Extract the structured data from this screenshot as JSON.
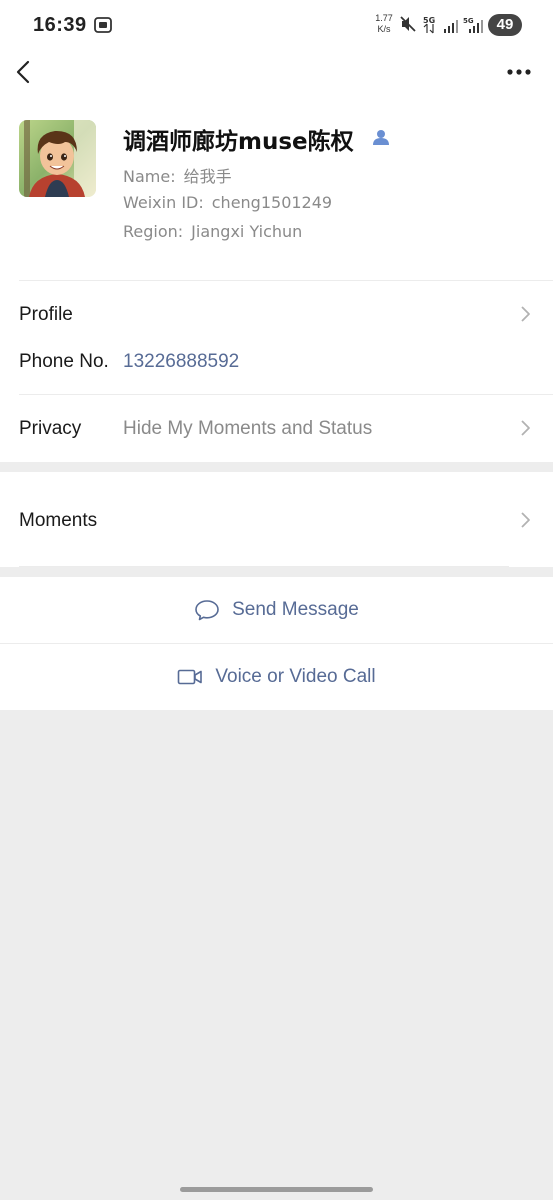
{
  "status_bar": {
    "time": "16:39",
    "net_speed_value": "1.77",
    "net_speed_unit": "K/s",
    "signal1_label": "5G",
    "signal2_label": "5G",
    "battery": "49"
  },
  "profile": {
    "display_name": "调酒师廊坊muse陈权",
    "name_label": "Name:",
    "name_value": "给我手",
    "weixin_label": "Weixin ID:",
    "weixin_value": "cheng1501249",
    "region_label": "Region:",
    "region_value": "Jiangxi  Yichun"
  },
  "rows": {
    "profile_label": "Profile",
    "phone_label": "Phone No.",
    "phone_value": "13226888592",
    "privacy_label": "Privacy",
    "privacy_value": "Hide My Moments and Status",
    "moments_label": "Moments"
  },
  "actions": {
    "send_message": "Send Message",
    "call": "Voice or Video Call"
  },
  "colors": {
    "link": "#576b95",
    "background": "#ededed"
  },
  "icons": [
    "back-icon",
    "more-icon",
    "contact-person-icon",
    "chevron-right-icon",
    "chat-bubble-icon",
    "video-camera-icon"
  ]
}
